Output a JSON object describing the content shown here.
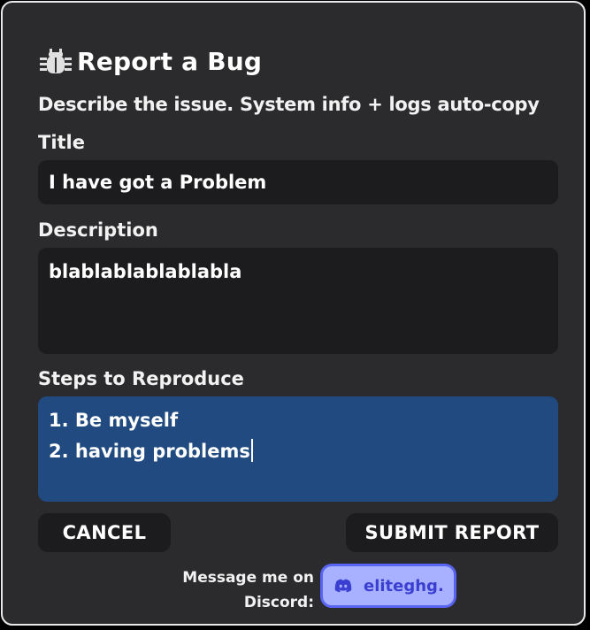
{
  "dialog": {
    "title": "Report a Bug",
    "title_icon": "bug-icon",
    "subtitle": "Describe the issue. System info + logs auto-copy"
  },
  "form": {
    "title_label": "Title",
    "title_value": "I have got a Problem",
    "description_label": "Description",
    "description_value": "blablablablablabla",
    "steps_label": "Steps to Reproduce",
    "steps_lines": [
      "1. Be myself",
      "2. having problems"
    ]
  },
  "actions": {
    "cancel_label": "CANCEL",
    "submit_label": "SUBMIT REPORT"
  },
  "contact": {
    "line1": "Message me on",
    "line2": "Discord:",
    "discord_icon": "discord-icon",
    "discord_handle": "eliteghg."
  },
  "colors": {
    "dialog_bg": "#2b2b2d",
    "field_bg": "#1c1c1e",
    "focused_field_bg": "#204a80",
    "discord_bg": "#a7b1ff",
    "discord_border": "#5865f2"
  }
}
